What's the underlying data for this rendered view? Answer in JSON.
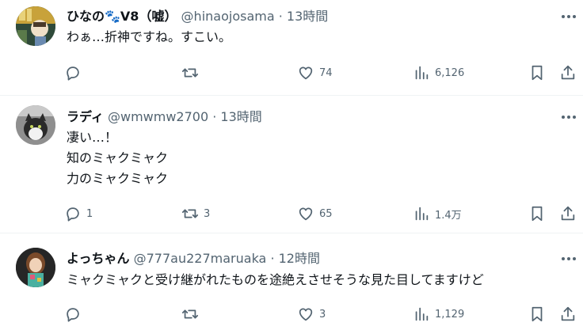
{
  "tweets": [
    {
      "name": "ひなの🐾V8（嘘）",
      "handle": "@hinaojosama",
      "dot": " · ",
      "time": "13時間",
      "lines": [
        "わぁ…折神ですね。すこい。"
      ],
      "replies": "",
      "retweets": "",
      "likes": "74",
      "views": "6,126"
    },
    {
      "name": "ラディ",
      "handle": "@wmwmw2700",
      "dot": " · ",
      "time": "13時間",
      "lines": [
        "凄い…！",
        "知のミャクミャク",
        "力のミャクミャク"
      ],
      "replies": "1",
      "retweets": "3",
      "likes": "65",
      "views": "1.4万"
    },
    {
      "name": "よっちゃん",
      "handle": "@777au227maruaka",
      "dot": " · ",
      "time": "12時間",
      "lines": [
        "ミャクミャクと受け継がれたものを途絶えさせそうな見た目してますけど"
      ],
      "replies": "",
      "retweets": "",
      "likes": "3",
      "views": "1,129"
    }
  ],
  "icons": {
    "reply": "reply-icon",
    "retweet": "retweet-icon",
    "like": "heart-icon",
    "views": "views-icon",
    "bookmark": "bookmark-icon",
    "share": "share-icon",
    "more": "more-icon"
  },
  "colors": {
    "text": "#0f1419",
    "secondary": "#536471",
    "divider": "#eff3f4"
  }
}
